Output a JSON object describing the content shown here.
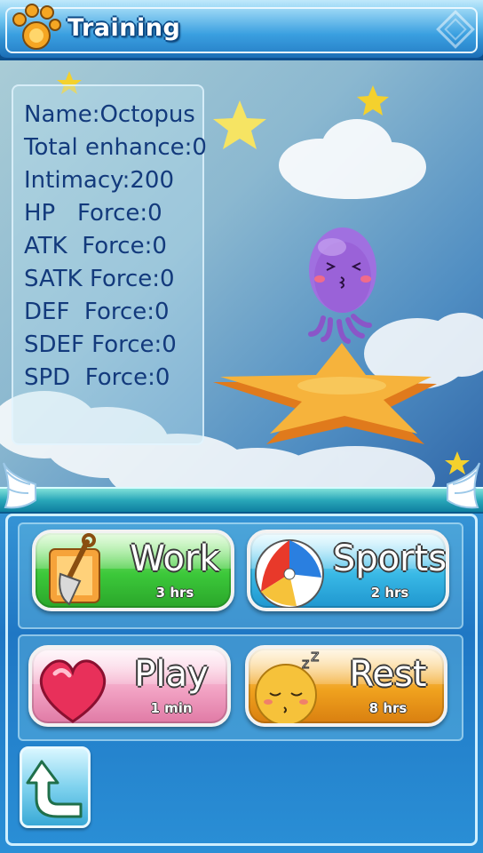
{
  "header": {
    "title": "Training"
  },
  "info": {
    "lines": [
      "Name:Octopus",
      "Total enhance:0",
      "Intimacy:200",
      "HP   Force:0",
      "ATK  Force:0",
      "SATK Force:0",
      "DEF  Force:0",
      "SDEF Force:0",
      "SPD  Force:0"
    ]
  },
  "actions": {
    "work": {
      "label": "Work",
      "duration": "3 hrs"
    },
    "sports": {
      "label": "Sports",
      "duration": "2 hrs"
    },
    "play": {
      "label": "Play",
      "duration": "1 min"
    },
    "rest": {
      "label": "Rest",
      "duration": "8 hrs"
    }
  },
  "colors": {
    "work": "#3cc83a",
    "sports": "#39b9e6",
    "play": "#f2a3c4",
    "rest": "#f0a21e",
    "title_bg": "#2f8fd1",
    "info_text": "#133a7c"
  },
  "icons": {
    "header": "paw-icon",
    "work": "shovel-icon",
    "sports": "beach-ball-icon",
    "play": "heart-icon",
    "rest": "sleeping-face-icon",
    "back": "back-arrow-icon"
  }
}
